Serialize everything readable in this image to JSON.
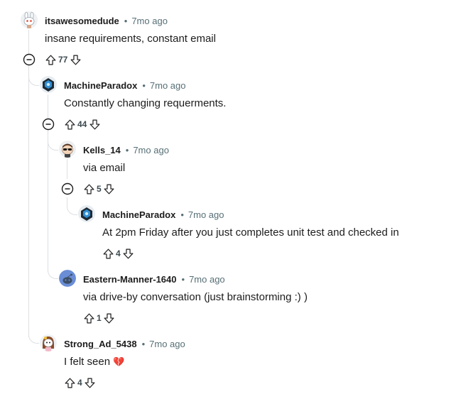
{
  "comments": [
    {
      "author": "itsawesomedude",
      "time": "7mo ago",
      "body": "insane requirements, constant email",
      "score": "77",
      "avatar": "snoo-bunny-avatar",
      "collapsible": true
    },
    {
      "author": "MachineParadox",
      "time": "7mo ago",
      "body": "Constantly changing requerments.",
      "score": "44",
      "avatar": "robot-avatar",
      "collapsible": true
    },
    {
      "author": "Kells_14",
      "time": "7mo ago",
      "body": "via email",
      "score": "5",
      "avatar": "sunglasses-avatar",
      "collapsible": true
    },
    {
      "author": "MachineParadox",
      "time": "7mo ago",
      "body": "At 2pm Friday after you just completes unit test and checked in",
      "score": "4",
      "avatar": "robot-avatar",
      "collapsible": false
    },
    {
      "author": "Eastern-Manner-1640",
      "time": "7mo ago",
      "body": "via drive-by conversation (just brainstorming :) )",
      "score": "1",
      "avatar": "default-snoo-avatar",
      "collapsible": false
    },
    {
      "author": "Strong_Ad_5438",
      "time": "7mo ago",
      "body": "I felt seen",
      "emoji": "💔",
      "score": "4",
      "avatar": "girl-snoo-avatar",
      "collapsible": false
    }
  ],
  "meta_separator": "•",
  "colors": {
    "thread_line": "#dcdfe3",
    "muted": "#576f76",
    "text": "#1c1c1c",
    "default_avatar_blue": "#6a8dd6"
  }
}
